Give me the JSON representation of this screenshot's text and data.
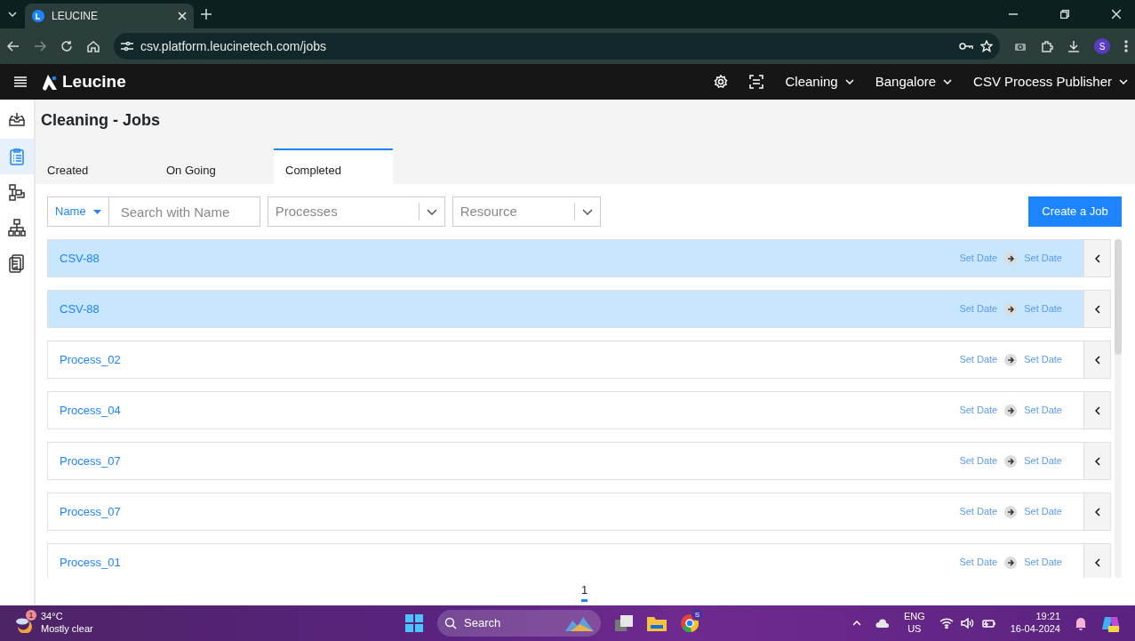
{
  "browser": {
    "tab_title": "LEUCINE",
    "url": "csv.platform.leucinetech.com/jobs",
    "profile_letter": "S"
  },
  "app": {
    "brand": "Leucine",
    "dropdowns": [
      "Cleaning",
      "Bangalore",
      "CSV Process Publisher"
    ]
  },
  "sidebar": {
    "items": [
      {
        "kind": "inbox",
        "selected": false
      },
      {
        "kind": "checklist",
        "selected": true
      },
      {
        "kind": "flow",
        "selected": false
      },
      {
        "kind": "hierarchy",
        "selected": false
      },
      {
        "kind": "report",
        "selected": false
      }
    ]
  },
  "page": {
    "title": "Cleaning - Jobs",
    "tabs": [
      {
        "label": "Created",
        "selected": false
      },
      {
        "label": "On Going",
        "selected": false
      },
      {
        "label": "Completed",
        "selected": true
      }
    ],
    "filters": {
      "field_selector": "Name",
      "search": {
        "placeholder": "Search with Name"
      },
      "dropdowns": [
        {
          "placeholder": "Processes"
        },
        {
          "placeholder": "Resource"
        }
      ]
    },
    "create_button": "Create a Job",
    "jobs": [
      {
        "name": "CSV-88",
        "selected": true,
        "start": "Set Date",
        "end": "Set Date"
      },
      {
        "name": "CSV-88",
        "selected": true,
        "start": "Set Date",
        "end": "Set Date"
      },
      {
        "name": "Process_02",
        "selected": false,
        "start": "Set Date",
        "end": "Set Date"
      },
      {
        "name": "Process_04",
        "selected": false,
        "start": "Set Date",
        "end": "Set Date"
      },
      {
        "name": "Process_07",
        "selected": false,
        "start": "Set Date",
        "end": "Set Date"
      },
      {
        "name": "Process_07",
        "selected": false,
        "start": "Set Date",
        "end": "Set Date"
      },
      {
        "name": "Process_01",
        "selected": false,
        "start": "Set Date",
        "end": "Set Date"
      }
    ],
    "pagination": [
      {
        "label": "1",
        "selected": true
      }
    ]
  },
  "taskbar": {
    "weather": {
      "temperature": "34°C",
      "condition": "Mostly clear",
      "badge": "1"
    },
    "search": {
      "placeholder": "Search"
    },
    "chrome_badge": "S",
    "language": [
      "ENG",
      "US"
    ],
    "time": "19:21",
    "date": "16-04-2024"
  }
}
